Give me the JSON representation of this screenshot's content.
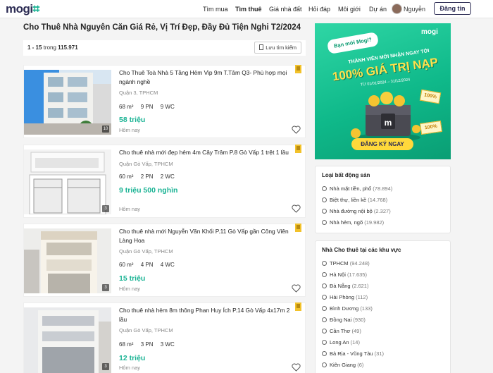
{
  "header": {
    "logo": "mogi",
    "nav": [
      "Tìm mua",
      "Tìm thuê",
      "Giá nhà đất",
      "Hỏi đáp",
      "Môi giới",
      "Dự án"
    ],
    "active_nav": "Tìm thuê",
    "user_name": "Nguyễn",
    "login_label": "Đăng tin"
  },
  "page": {
    "title": "Cho Thuê Nhà Nguyên Căn Giá Rẻ, Vị Trí Đẹp, Đầy Đủ Tiện Nghi T2/2024",
    "result_range": "1 - 15",
    "result_word": "trong",
    "result_total": "115.971",
    "save_search_label": "Lưu tìm kiếm"
  },
  "listings": [
    {
      "title": "Cho Thuê Toà Nhà 5 Tầng Hẻm Vip 9m T.Tâm Q3- Phù hợp mọi ngành nghề",
      "location": "Quận 3, TPHCM",
      "area": "68 m²",
      "bedrooms": "9 PN",
      "bathrooms": "9 WC",
      "price": "58 triệu",
      "date": "Hôm nay",
      "photos": "10",
      "vip": true
    },
    {
      "title": "Cho thuê nhà mới đẹp hẻm 4m Cây Trâm P.8 Gò Vấp 1 trệt 1 lầu",
      "location": "Quận Gò Vấp, TPHCM",
      "area": "60 m²",
      "bedrooms": "2 PN",
      "bathrooms": "2 WC",
      "price": "9 triệu 500 nghìn",
      "date": "Hôm nay",
      "photos": "3",
      "vip": true
    },
    {
      "title": "Cho thuê nhà mới Nguyễn Văn Khối P.11 Gò Vấp gần Công Viên Làng Hoa",
      "location": "Quận Gò Vấp, TPHCM",
      "area": "60 m²",
      "bedrooms": "4 PN",
      "bathrooms": "4 WC",
      "price": "15 triệu",
      "date": "Hôm nay",
      "photos": "3",
      "vip": true
    },
    {
      "title": "Cho thuê nhà hẻm 8m thông Phan Huy Ích P.14 Gò Vấp 4x17m 2 lầu",
      "location": "Quận Gò Vấp, TPHCM",
      "area": "68 m²",
      "bedrooms": "3 PN",
      "bathrooms": "3 WC",
      "price": "12 triệu",
      "date": "Hôm nay",
      "photos": "3",
      "vip": true
    }
  ],
  "banner": {
    "brand": "mogi",
    "bubble": "Bạn mới Mogi?",
    "headline_small": "THÀNH VIÊN MỚI NHẬN NGAY TỚI",
    "headline_big": "100% GIÁ TRỊ NẠP",
    "dates": "TỪ 01/01/2024 – 31/12/2024",
    "cta": "ĐĂNG KÝ NGAY",
    "badge": "100%"
  },
  "property_types": {
    "title": "Loại bất động sản",
    "items": [
      {
        "label": "Nhà mặt tiền, phố",
        "count": "(78.894)"
      },
      {
        "label": "Biệt thự, liền kề",
        "count": "(14.768)"
      },
      {
        "label": "Nhà đường nội bộ",
        "count": "(2.327)"
      },
      {
        "label": "Nhà hẻm, ngõ",
        "count": "(19.982)"
      }
    ]
  },
  "regions": {
    "title": "Nhà Cho thuê tại các khu vực",
    "items": [
      {
        "label": "TPHCM",
        "count": "(94.248)"
      },
      {
        "label": "Hà Nội",
        "count": "(17.635)"
      },
      {
        "label": "Đà Nẵng",
        "count": "(2.621)"
      },
      {
        "label": "Hải Phòng",
        "count": "(112)"
      },
      {
        "label": "Bình Dương",
        "count": "(133)"
      },
      {
        "label": "Đồng Nai",
        "count": "(930)"
      },
      {
        "label": "Cần Thơ",
        "count": "(49)"
      },
      {
        "label": "Long An",
        "count": "(14)"
      },
      {
        "label": "Bà Rịa - Vũng Tàu",
        "count": "(31)"
      },
      {
        "label": "Kiên Giang",
        "count": "(6)"
      }
    ]
  },
  "colors": {
    "brand": "#2c2c54",
    "accent": "#1ab394",
    "vip": "#f2c22b"
  }
}
